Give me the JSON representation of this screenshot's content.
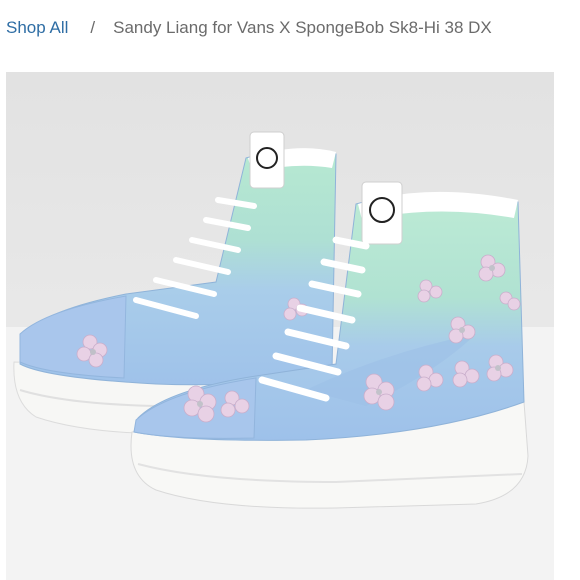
{
  "breadcrumb": {
    "root_label": "Shop All",
    "separator": "/",
    "current_label": "Sandy Liang for Vans X SpongeBob Sk8-Hi 38 DX"
  },
  "product_image": {
    "icon": "sneaker-photo",
    "colors": {
      "upper_blue": "#a9c8ec",
      "collar_mint": "#b5e6cf",
      "sole_white": "#f7f7f5",
      "laces_white": "#ffffff",
      "flower_pink": "#e7cfe3",
      "background": "#e6e6e6"
    }
  }
}
